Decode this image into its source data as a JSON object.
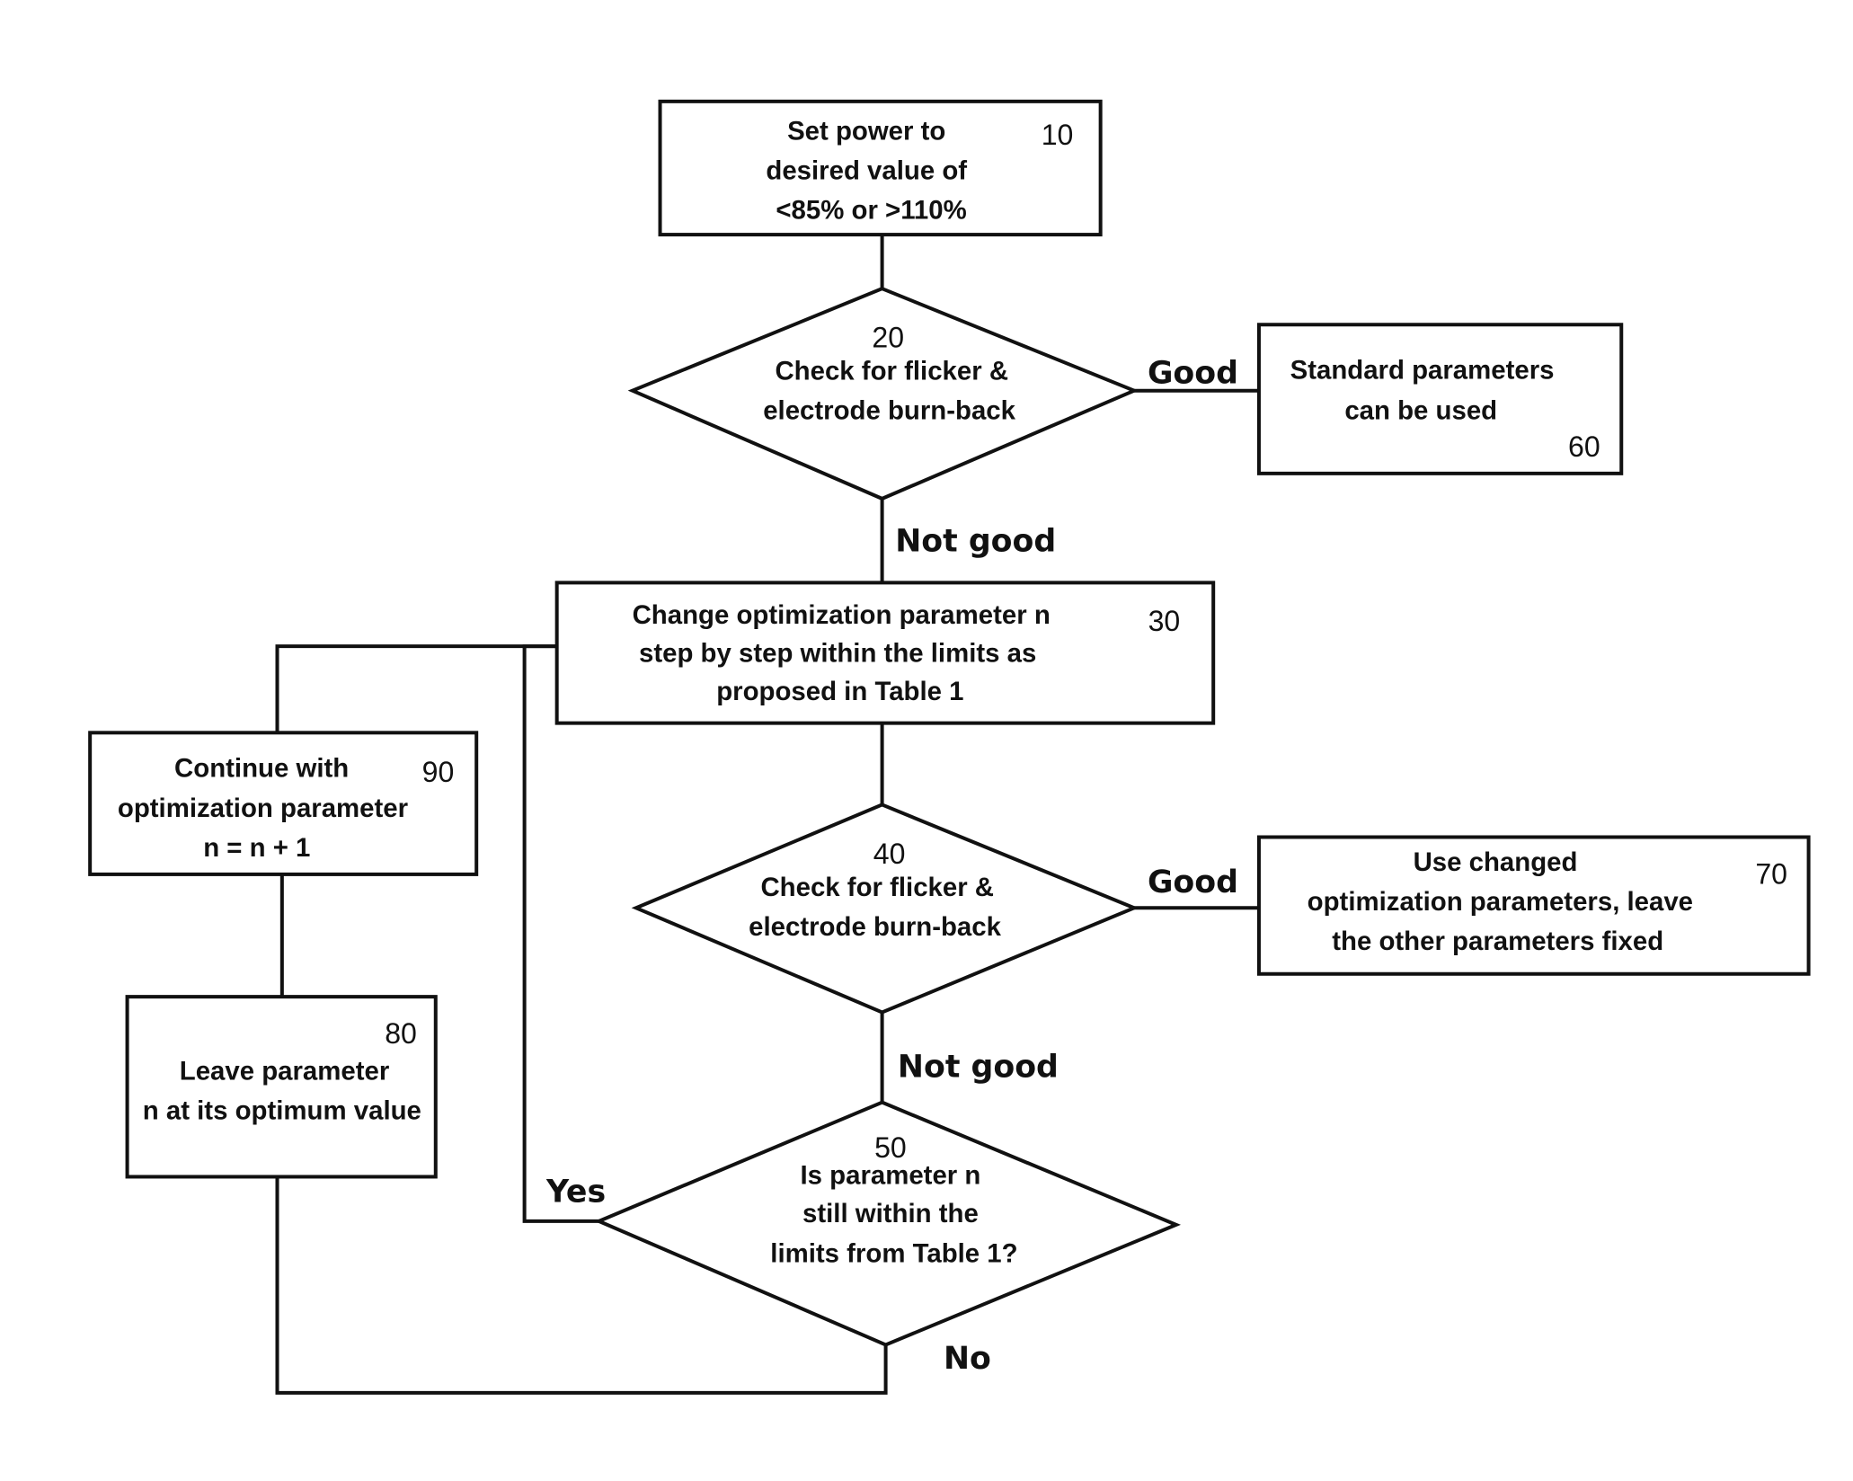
{
  "diagram": {
    "type": "flowchart",
    "nodes": {
      "n10": {
        "id": "10",
        "shape": "process",
        "lines": [
          "Set power to",
          "desired value of",
          "<85% or >110%"
        ]
      },
      "n20": {
        "id": "20",
        "shape": "decision",
        "lines": [
          "Check for flicker &",
          "electrode burn-back"
        ]
      },
      "n30": {
        "id": "30",
        "shape": "process",
        "lines": [
          "Change optimization parameter n",
          "step by step within the limits as",
          "proposed in Table 1"
        ]
      },
      "n40": {
        "id": "40",
        "shape": "decision",
        "lines": [
          "Check for flicker &",
          "electrode burn-back"
        ]
      },
      "n50": {
        "id": "50",
        "shape": "decision",
        "lines": [
          "Is parameter n",
          "still within the",
          "limits from Table 1?"
        ]
      },
      "n60": {
        "id": "60",
        "shape": "process",
        "lines": [
          "Standard parameters",
          "can be used"
        ]
      },
      "n70": {
        "id": "70",
        "shape": "process",
        "lines": [
          "Use changed",
          "optimization parameters, leave",
          "the other parameters fixed"
        ]
      },
      "n80": {
        "id": "80",
        "shape": "process",
        "lines": [
          "Leave parameter",
          "n at its optimum value"
        ]
      },
      "n90": {
        "id": "90",
        "shape": "process",
        "lines": [
          "Continue with",
          "optimization parameter",
          "n = n + 1"
        ]
      }
    },
    "edge_labels": {
      "e20_60": "Good",
      "e20_30": "Not good",
      "e40_70": "Good",
      "e40_50": "Not good",
      "e50_30": "Yes",
      "e50_80": "No"
    },
    "edges": [
      {
        "from": "10",
        "to": "20"
      },
      {
        "from": "20",
        "to": "60",
        "label": "Good"
      },
      {
        "from": "20",
        "to": "30",
        "label": "Not good"
      },
      {
        "from": "30",
        "to": "40"
      },
      {
        "from": "40",
        "to": "70",
        "label": "Good"
      },
      {
        "from": "40",
        "to": "50",
        "label": "Not good"
      },
      {
        "from": "50",
        "to": "30",
        "label": "Yes"
      },
      {
        "from": "50",
        "to": "80",
        "label": "No"
      },
      {
        "from": "80",
        "to": "90"
      },
      {
        "from": "90",
        "to": "30"
      }
    ]
  }
}
